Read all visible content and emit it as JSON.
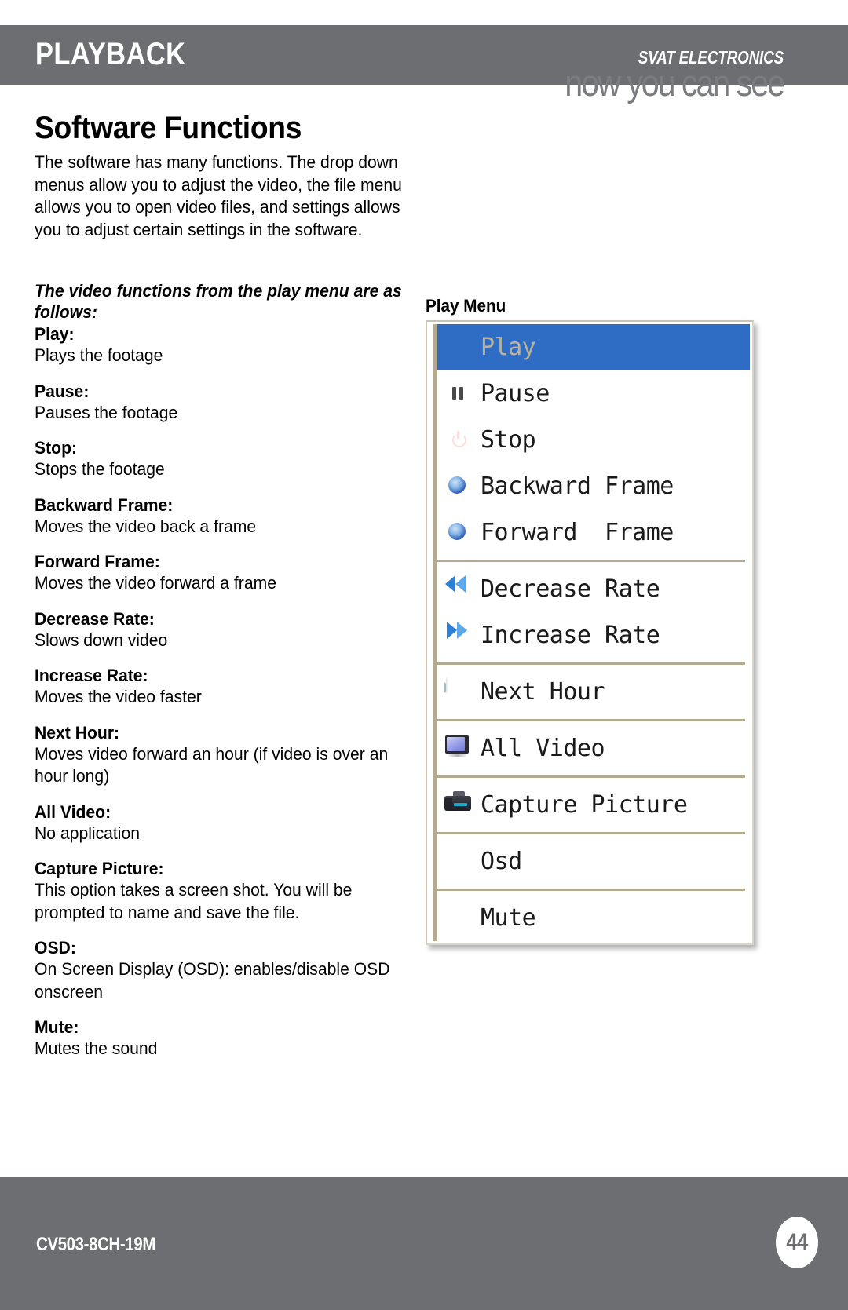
{
  "header": {
    "section_title": "PLAYBACK",
    "brand_name": "SVAT ELECTRONICS",
    "brand_tagline": "now you can see",
    "bar_color": "#6d6e71"
  },
  "main": {
    "page_title": "Software Functions",
    "intro": "The software has many functions. The drop down menus allow you to adjust the video, the file menu allows you to open video files, and settings allows you to adjust certain settings in the software.",
    "section_lead": "The video functions from the play menu are as follows:",
    "terms": [
      {
        "name": "Play:",
        "desc": "Plays the footage"
      },
      {
        "name": "Pause:",
        "desc": "Pauses the footage"
      },
      {
        "name": "Stop:",
        "desc": "Stops the footage"
      },
      {
        "name": "Backward Frame:",
        "desc": "Moves the video back a frame"
      },
      {
        "name": "Forward Frame:",
        "desc": "Moves the video forward a frame"
      },
      {
        "name": "Decrease Rate:",
        "desc": "Slows down video"
      },
      {
        "name": "Increase Rate:",
        "desc": "Moves the video faster"
      },
      {
        "name": "Next Hour:",
        "desc": "Moves video forward an hour (if video is over an hour long)"
      },
      {
        "name": "All Video:",
        "desc": "No application"
      },
      {
        "name": "Capture Picture:",
        "desc": "This option takes a screen shot.  You will be prompted to name and save the file."
      },
      {
        "name": "OSD:",
        "desc": "On Screen Display (OSD): enables/disable OSD onscreen"
      },
      {
        "name": "Mute:",
        "desc": "Mutes the sound"
      }
    ]
  },
  "play_menu": {
    "caption": "Play Menu",
    "highlight_color": "#2f6dc4",
    "selected_text_color": "#b8b2a0",
    "separator_color": "#b3ab91",
    "items": [
      {
        "label": "Play",
        "icon": "none",
        "selected": true,
        "separator_after": false
      },
      {
        "label": "Pause",
        "icon": "pause-icon",
        "selected": false,
        "separator_after": false
      },
      {
        "label": "Stop",
        "icon": "stop-icon",
        "selected": false,
        "separator_after": false
      },
      {
        "label": "Backward Frame",
        "icon": "backward-frame-icon",
        "selected": false,
        "separator_after": false
      },
      {
        "label": "Forward  Frame",
        "icon": "forward-frame-icon",
        "selected": false,
        "separator_after": true
      },
      {
        "label": "Decrease Rate",
        "icon": "rewind-icon",
        "selected": false,
        "separator_after": false
      },
      {
        "label": "Increase Rate",
        "icon": "fast-forward-icon",
        "selected": false,
        "separator_after": true
      },
      {
        "label": "Next Hour",
        "icon": "document-icon",
        "selected": false,
        "separator_after": true
      },
      {
        "label": "All Video",
        "icon": "monitor-icon",
        "selected": false,
        "separator_after": true
      },
      {
        "label": "Capture Picture",
        "icon": "camera-icon",
        "selected": false,
        "separator_after": true
      },
      {
        "label": "Osd",
        "icon": "none",
        "selected": false,
        "separator_after": true
      },
      {
        "label": "Mute",
        "icon": "mute-icon",
        "selected": false,
        "separator_after": false
      }
    ]
  },
  "footer": {
    "model_code": "CV503-8CH-19M",
    "page_number": "44",
    "bar_color": "#6d6e71"
  }
}
